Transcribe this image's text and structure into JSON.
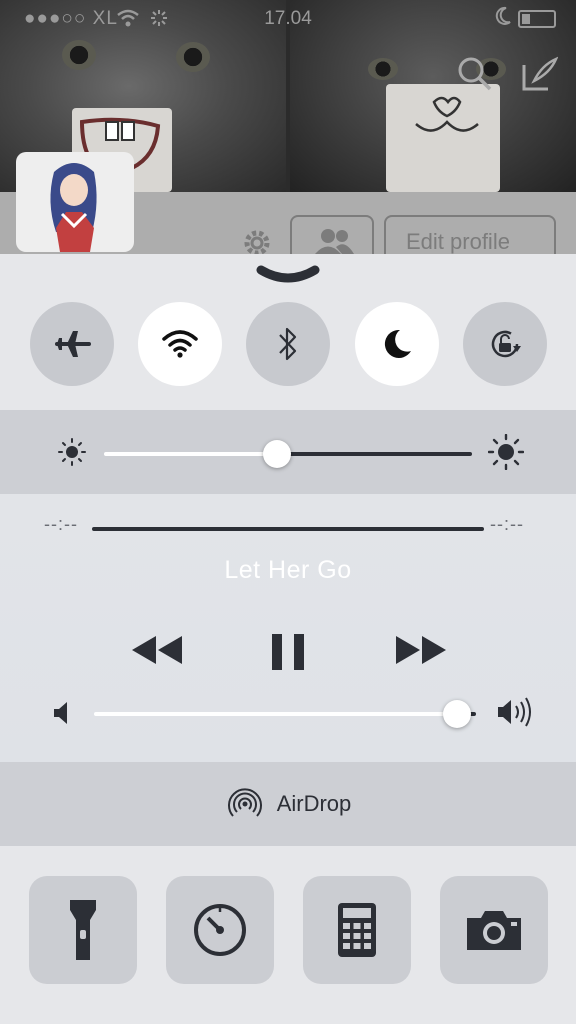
{
  "status_bar": {
    "carrier": "●●●○○ XL",
    "time": "17.04"
  },
  "background_app": {
    "edit_profile_label": "Edit profile"
  },
  "control_center": {
    "toggles": [
      {
        "name": "airplane-mode",
        "icon": "airplane-icon",
        "on": false
      },
      {
        "name": "wifi",
        "icon": "wifi-icon",
        "on": true
      },
      {
        "name": "bluetooth",
        "icon": "bluetooth-icon",
        "on": false
      },
      {
        "name": "do-not-disturb",
        "icon": "moon-icon",
        "on": true
      },
      {
        "name": "rotation-lock",
        "icon": "rotation-lock-icon",
        "on": false
      }
    ],
    "brightness": {
      "value": 0.47
    },
    "music": {
      "elapsed": "--:--",
      "remaining": "--:--",
      "title": "Let Her Go",
      "volume": 0.95
    },
    "airdrop": {
      "label": "AirDrop"
    },
    "shortcuts": [
      {
        "name": "flashlight",
        "icon": "flashlight-icon"
      },
      {
        "name": "timer",
        "icon": "timer-icon"
      },
      {
        "name": "calculator",
        "icon": "calculator-icon"
      },
      {
        "name": "camera",
        "icon": "camera-icon"
      }
    ]
  },
  "colors": {
    "panel": "#e6e7ea",
    "band": "#cdcfd4",
    "toggle_off": "#c7c9ce",
    "toggle_on": "#ffffff",
    "dark": "#2c2f36"
  }
}
